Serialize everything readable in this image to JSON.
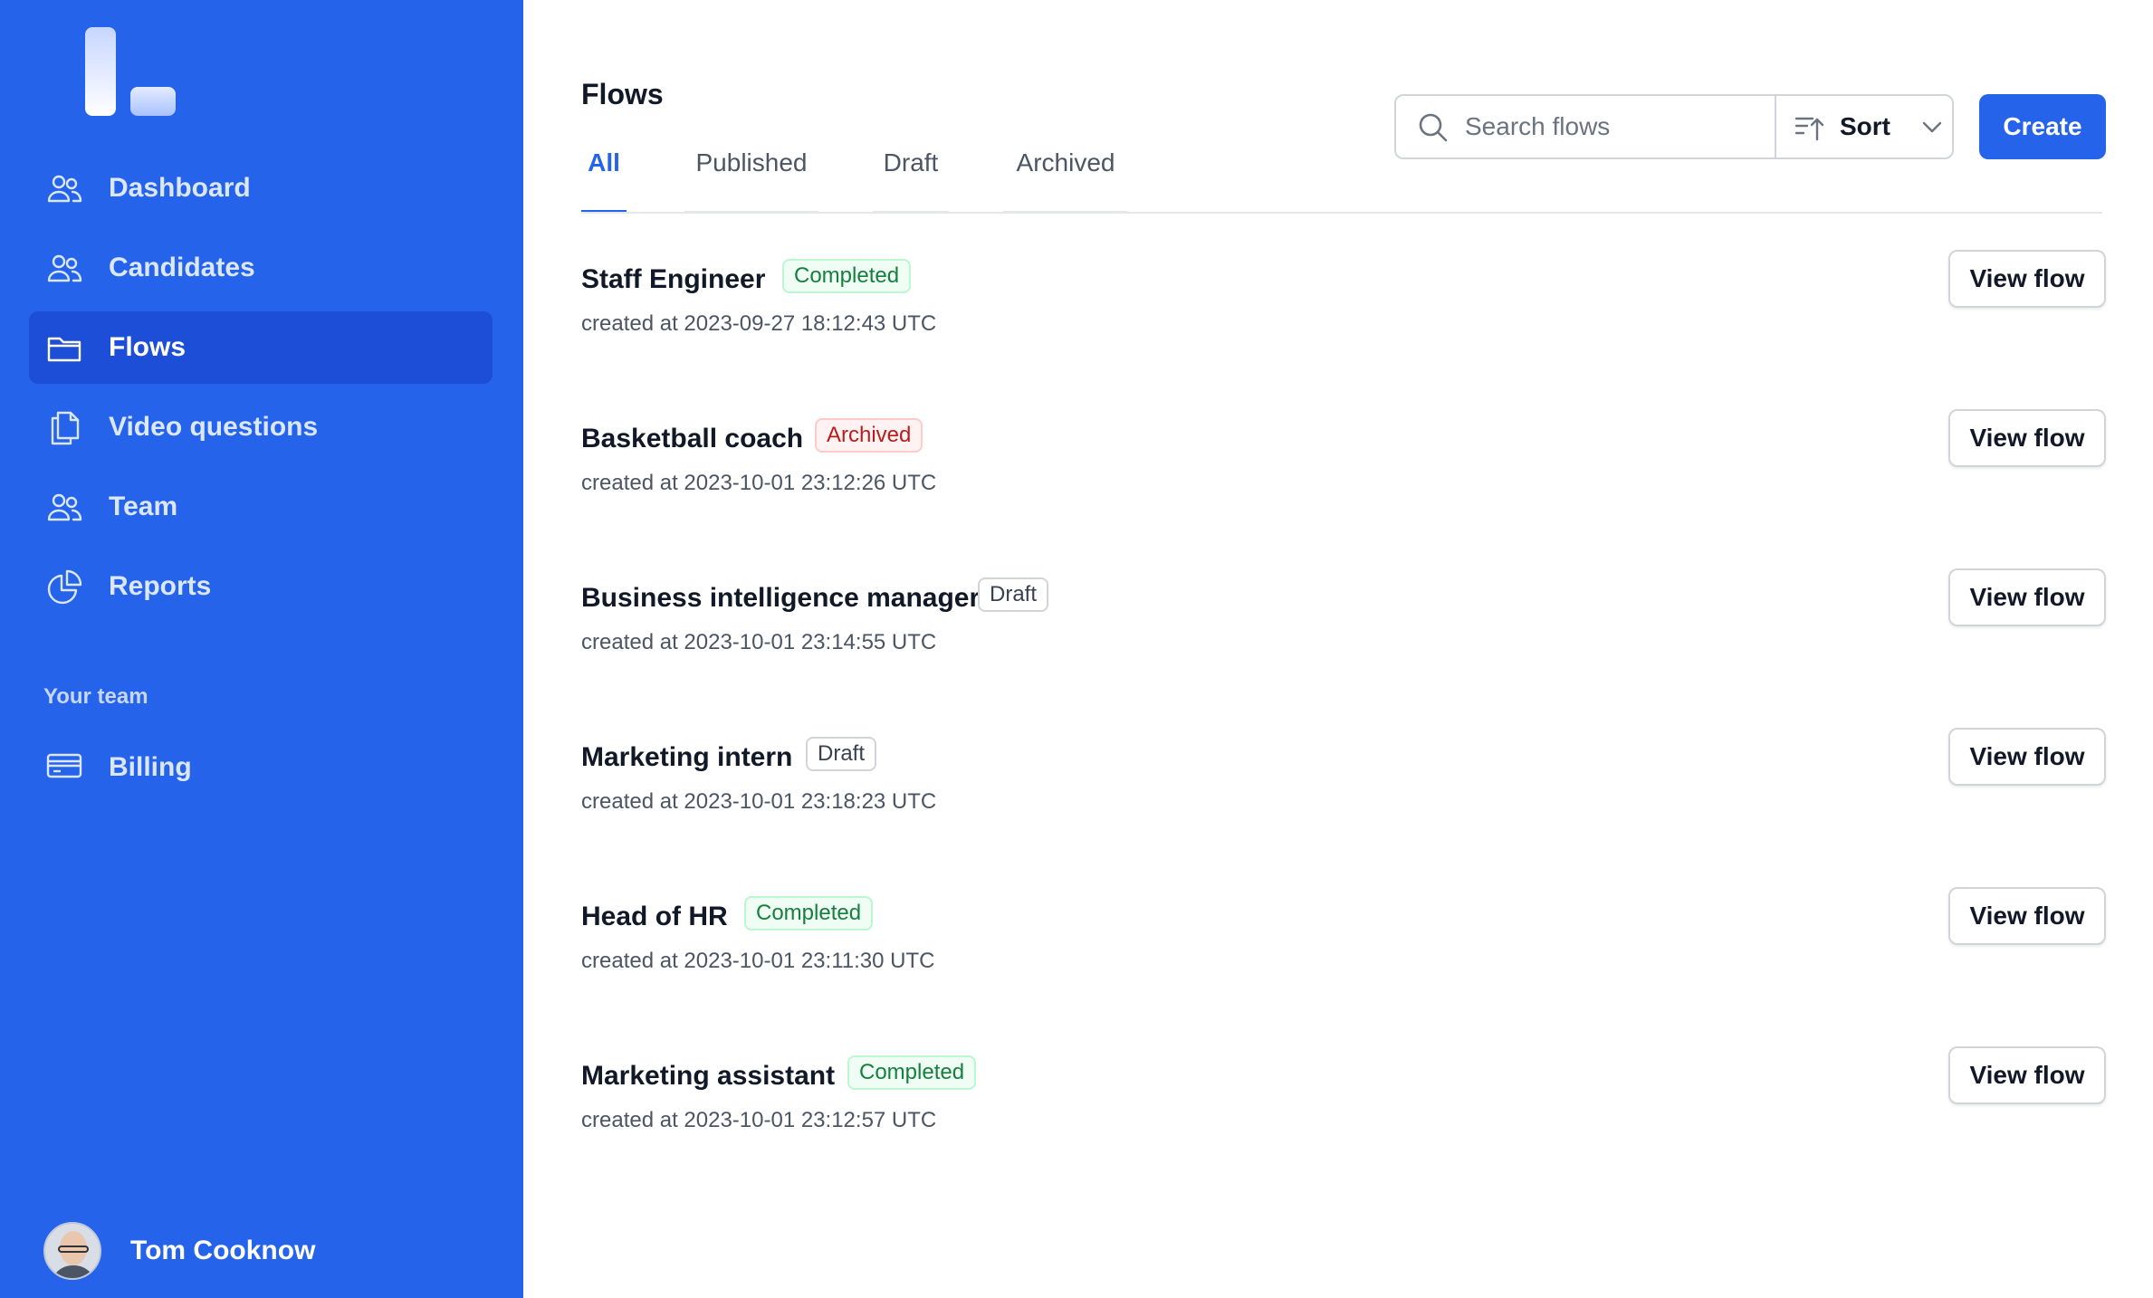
{
  "sidebar": {
    "logo": "logo-mark",
    "nav": [
      {
        "label": "Dashboard",
        "icon": "users-icon",
        "active": false
      },
      {
        "label": "Candidates",
        "icon": "users-icon",
        "active": false
      },
      {
        "label": "Flows",
        "icon": "folder-icon",
        "active": true
      },
      {
        "label": "Video questions",
        "icon": "documents-icon",
        "active": false
      },
      {
        "label": "Team",
        "icon": "users-icon",
        "active": false
      },
      {
        "label": "Reports",
        "icon": "pie-chart-icon",
        "active": false
      }
    ],
    "section_label": "Your team",
    "team_nav": [
      {
        "label": "Billing",
        "icon": "credit-card-icon"
      }
    ],
    "user": {
      "name": "Tom Cooknow"
    }
  },
  "main": {
    "title": "Flows",
    "tabs": [
      {
        "label": "All",
        "active": true
      },
      {
        "label": "Published",
        "active": false
      },
      {
        "label": "Draft",
        "active": false
      },
      {
        "label": "Archived",
        "active": false
      }
    ],
    "search": {
      "placeholder": "Search flows",
      "value": ""
    },
    "sort_label": "Sort",
    "create_label": "Create",
    "flows": [
      {
        "name": "Staff Engineer",
        "status": "Completed",
        "created": "created at 2023-09-27 18:12:43 UTC",
        "action": "View flow"
      },
      {
        "name": "Basketball coach",
        "status": "Archived",
        "created": "created at 2023-10-01 23:12:26 UTC",
        "action": "View flow"
      },
      {
        "name": "Business intelligence manager",
        "status": "Draft",
        "created": "created at 2023-10-01 23:14:55 UTC",
        "action": "View flow"
      },
      {
        "name": "Marketing intern",
        "status": "Draft",
        "created": "created at 2023-10-01 23:18:23 UTC",
        "action": "View flow"
      },
      {
        "name": "Head of HR",
        "status": "Completed",
        "created": "created at 2023-10-01 23:11:30 UTC",
        "action": "View flow"
      },
      {
        "name": "Marketing assistant",
        "status": "Completed",
        "created": "created at 2023-10-01 23:12:57 UTC",
        "action": "View flow"
      }
    ]
  },
  "colors": {
    "brand": "#2563eb",
    "sidebar_active": "#1d4ed8",
    "completed": "#15803d",
    "archived": "#b91c1c",
    "draft": "#374151"
  }
}
